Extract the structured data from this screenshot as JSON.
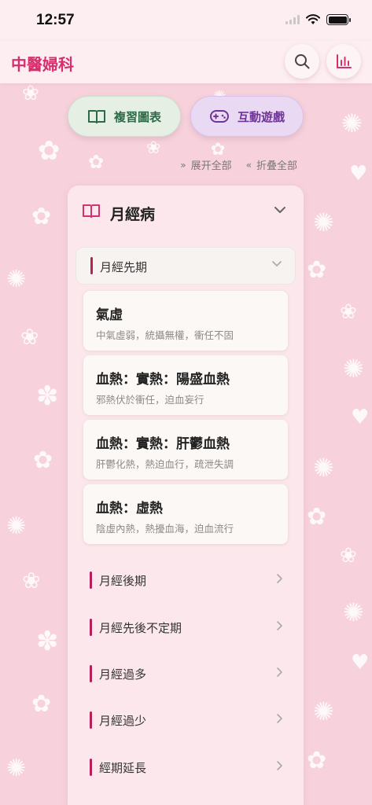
{
  "status": {
    "time": "12:57"
  },
  "header": {
    "title": "中醫婦科"
  },
  "actions": {
    "review_label": "複習圖表",
    "game_label": "互動遊戲"
  },
  "controls": {
    "expand_label": "展开全部",
    "collapse_label": "折叠全部"
  },
  "section": {
    "title": "月經病",
    "open_item": {
      "label": "月經先期",
      "entries": [
        {
          "title": "氣虛",
          "desc": "中氣虛弱，統攝無權，衝任不固"
        },
        {
          "title": "血熱：實熱：陽盛血熱",
          "desc": "邪熱伏於衝任，迫血妄行"
        },
        {
          "title": "血熱：實熱：肝鬱血熱",
          "desc": "肝鬱化熱，熱迫血行，疏泄失調"
        },
        {
          "title": "血熱：虛熱",
          "desc": "陰虛內熱，熱擾血海，迫血流行"
        }
      ]
    },
    "items": [
      {
        "label": "月經後期"
      },
      {
        "label": "月經先後不定期"
      },
      {
        "label": "月經過多"
      },
      {
        "label": "月經過少"
      },
      {
        "label": "經期延長"
      }
    ]
  },
  "colors": {
    "accent": "#d62f6e",
    "background": "#f7d2dc",
    "review_green": "#2d6a47",
    "game_purple": "#6e3596"
  },
  "icons": {
    "search": "search-icon",
    "stats": "bar-chart-icon",
    "book": "book-icon",
    "gamepad": "gamepad-icon"
  }
}
